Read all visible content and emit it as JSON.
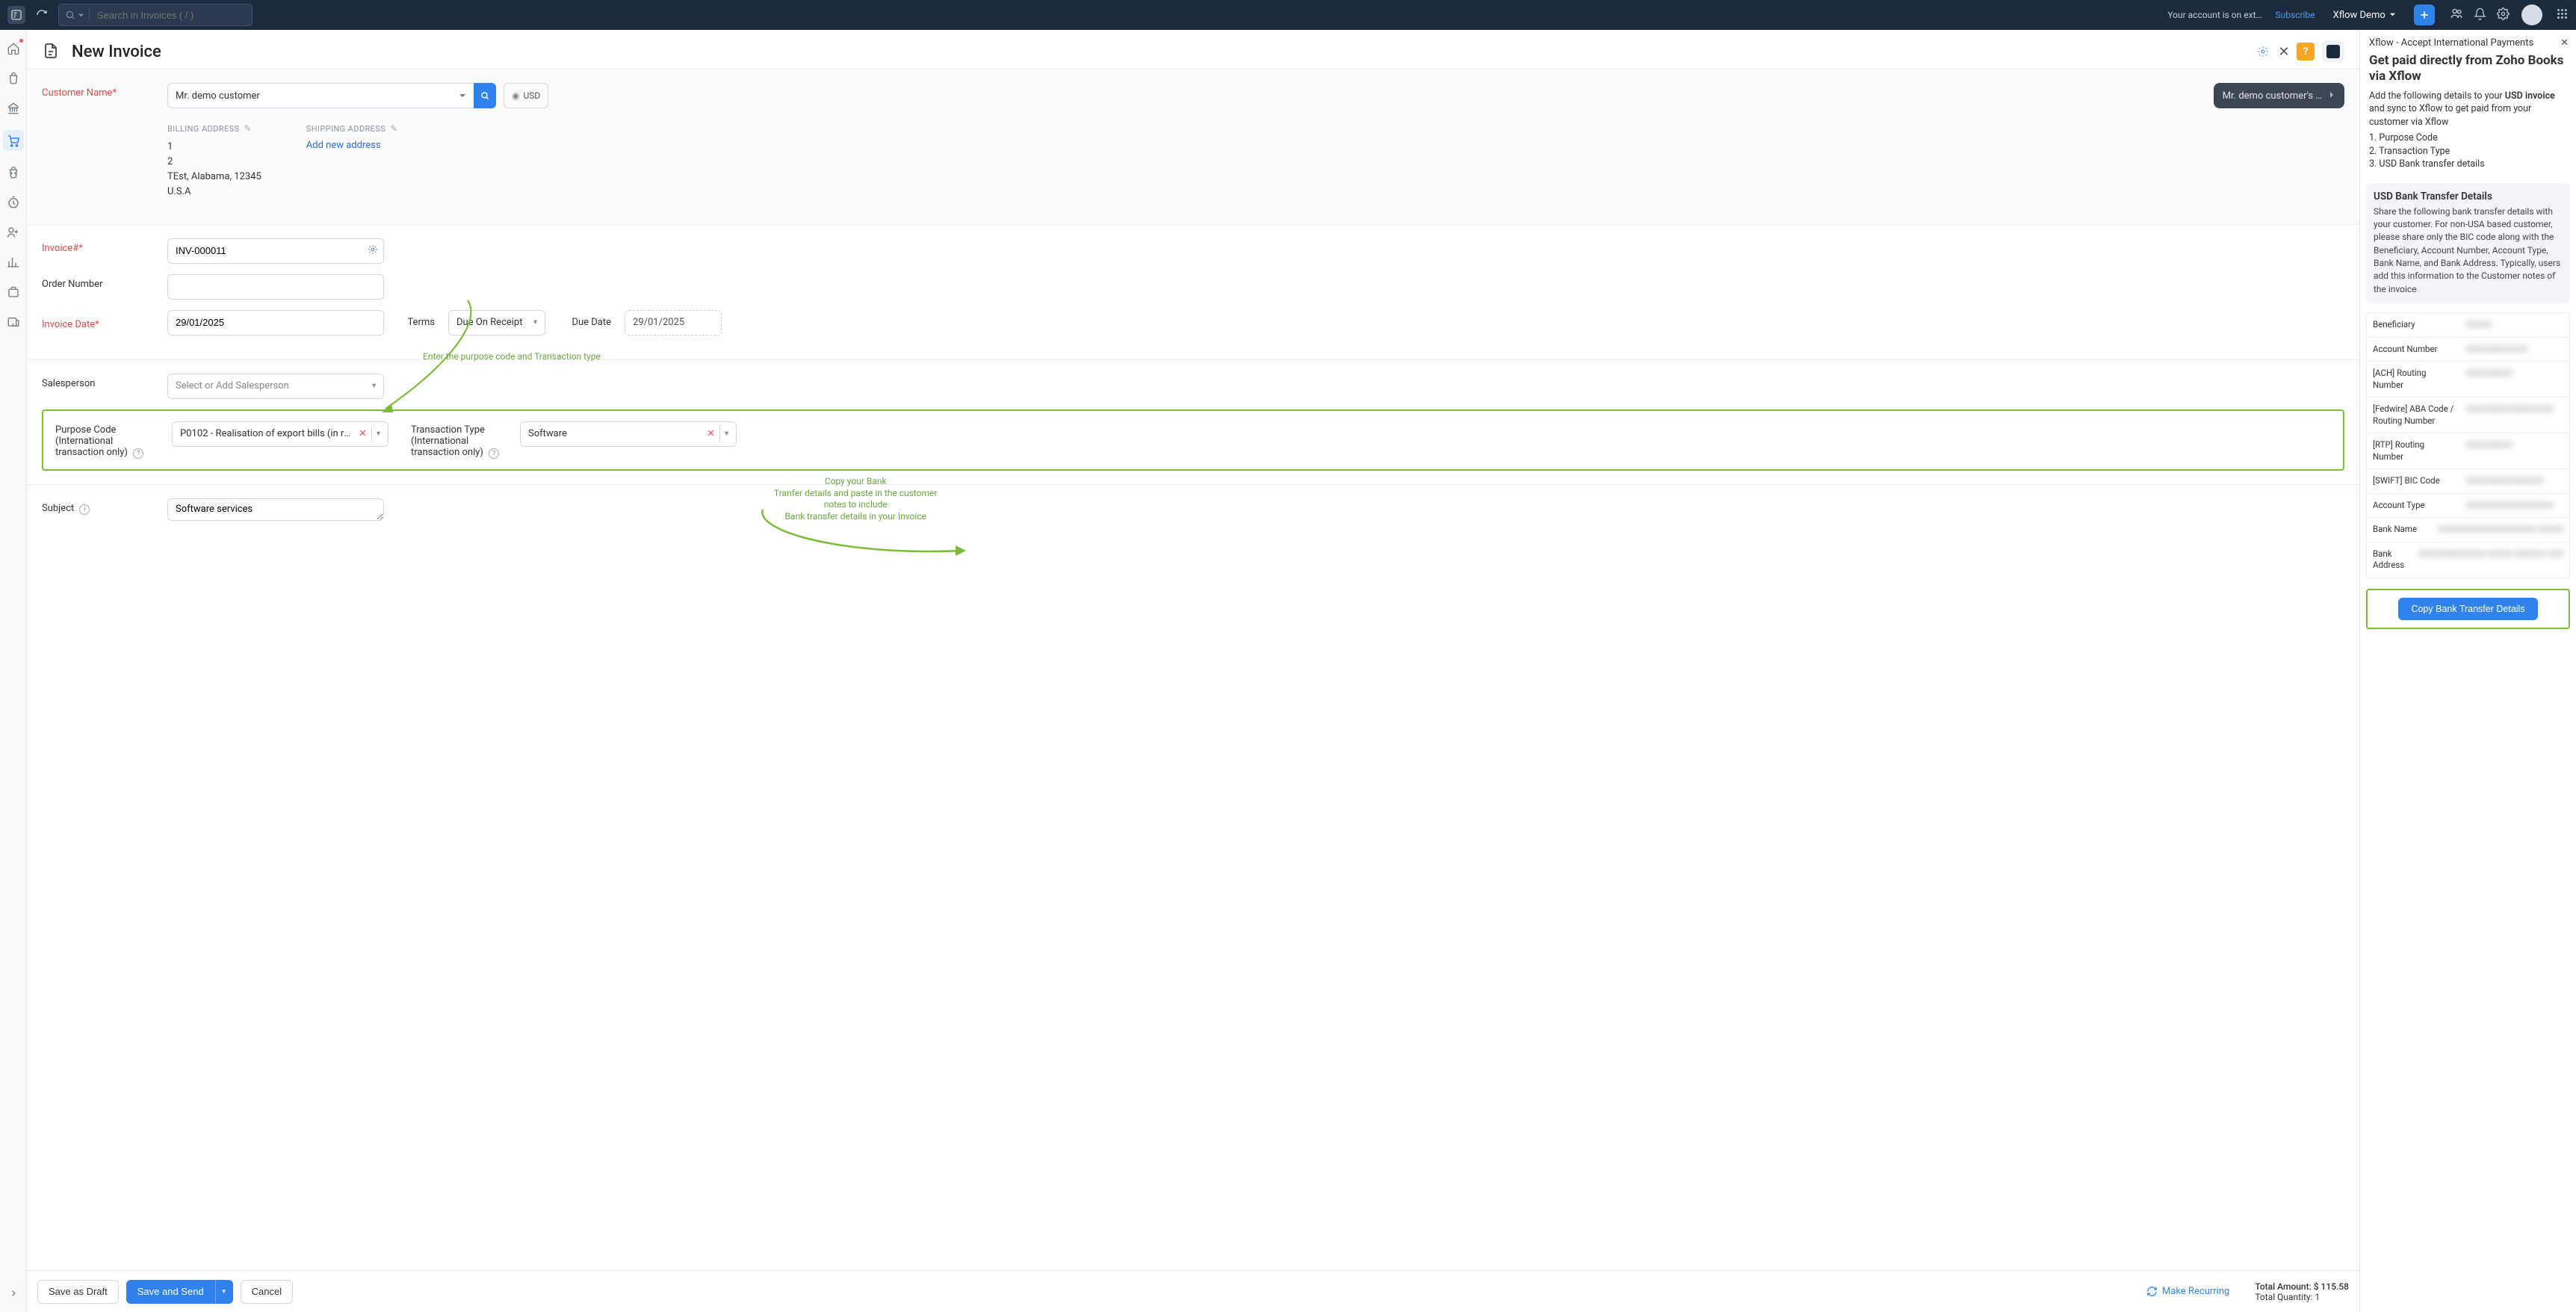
{
  "topbar": {
    "search_placeholder": "Search in Invoices ( / )",
    "account_text": "Your account is on ext…",
    "subscribe": "Subscribe",
    "org_name": "Xflow Demo"
  },
  "page": {
    "title": "New Invoice"
  },
  "labels": {
    "customer_name": "Customer Name*",
    "billing_address": "BILLING ADDRESS",
    "shipping_address": "SHIPPING ADDRESS",
    "add_new_address": "Add new address",
    "invoice_no": "Invoice#*",
    "order_number": "Order Number",
    "invoice_date": "Invoice Date*",
    "terms": "Terms",
    "due_date": "Due Date",
    "salesperson": "Salesperson",
    "purpose_code": "Purpose Code (International transaction only)",
    "transaction_type": "Transaction Type (International transaction only)",
    "subject": "Subject"
  },
  "form": {
    "customer_name": "Mr. demo customer",
    "currency": "USD",
    "customer_trans": "Mr. demo customer's …",
    "billing_lines": "1\n2\nTEst, Alabama, 12345\nU.S.A",
    "invoice_no": "INV-000011",
    "order_number": "",
    "invoice_date": "29/01/2025",
    "terms": "Due On Receipt",
    "due_date": "29/01/2025",
    "salesperson_placeholder": "Select or Add Salesperson",
    "purpose_code": "P0102 - Realisation of export bills (in res…",
    "transaction_type": "Software",
    "subject": "Software services"
  },
  "annotations": {
    "enter_purpose": "Enter the purpose code and Transaction type",
    "copy_bank": "Copy your Bank\nTranfer details and paste in the customer\nnotes to include\nBank transfer details in your Invoice"
  },
  "footer": {
    "save_draft": "Save as Draft",
    "save_send": "Save and Send",
    "cancel": "Cancel",
    "recurring": "Make Recurring",
    "total_amount": "Total Amount: $ 115.58",
    "total_qty": "Total Quantity: 1"
  },
  "rightpanel": {
    "header": "Xflow - Accept International Payments",
    "title": "Get paid directly from Zoho Books via Xflow",
    "desc_pre": "Add the following details to your ",
    "desc_bold": "USD invoice",
    "desc_post": " and sync to Xflow to get paid from your customer via Xflow",
    "bullets": [
      "1. Purpose Code",
      "2. Transaction Type",
      "3. USD Bank transfer details"
    ],
    "graybox_title": "USD Bank Transfer Details",
    "graybox_desc": "Share the following bank transfer details with your customer. For non-USA based customer, please share only the BIC code along with the Beneficiary, Account Number, Account Type, Bank Name, and Bank Address. Typically, users add this information to the Customer notes of the invoice",
    "table": [
      {
        "label": "Beneficiary",
        "value": "XXXXX"
      },
      {
        "label": "Account Number",
        "value": "XXXXXXXXXXXX"
      },
      {
        "label": "[ACH] Routing Number",
        "value": "XXXXXXXXX"
      },
      {
        "label": "[Fedwire] ABA Code / Routing Number",
        "value": "XXXXXXXXXXXXXXXXX"
      },
      {
        "label": "[RTP] Routing Number",
        "value": "XXXXXXXXX"
      },
      {
        "label": "[SWIFT] BIC Code",
        "value": "XXXXXXXXXXXXXXX"
      },
      {
        "label": "Account Type",
        "value": "XXXXXXXXXXXXXXXXX"
      },
      {
        "label": "Bank Name",
        "value": "XXXXXXXXXXXXXXXXXXX XXXXX"
      },
      {
        "label": "Bank Address",
        "value": "XXXXXXXXXXXXX XXXXX XXXXXX XXX"
      }
    ],
    "copy_btn": "Copy Bank Transfer Details"
  }
}
